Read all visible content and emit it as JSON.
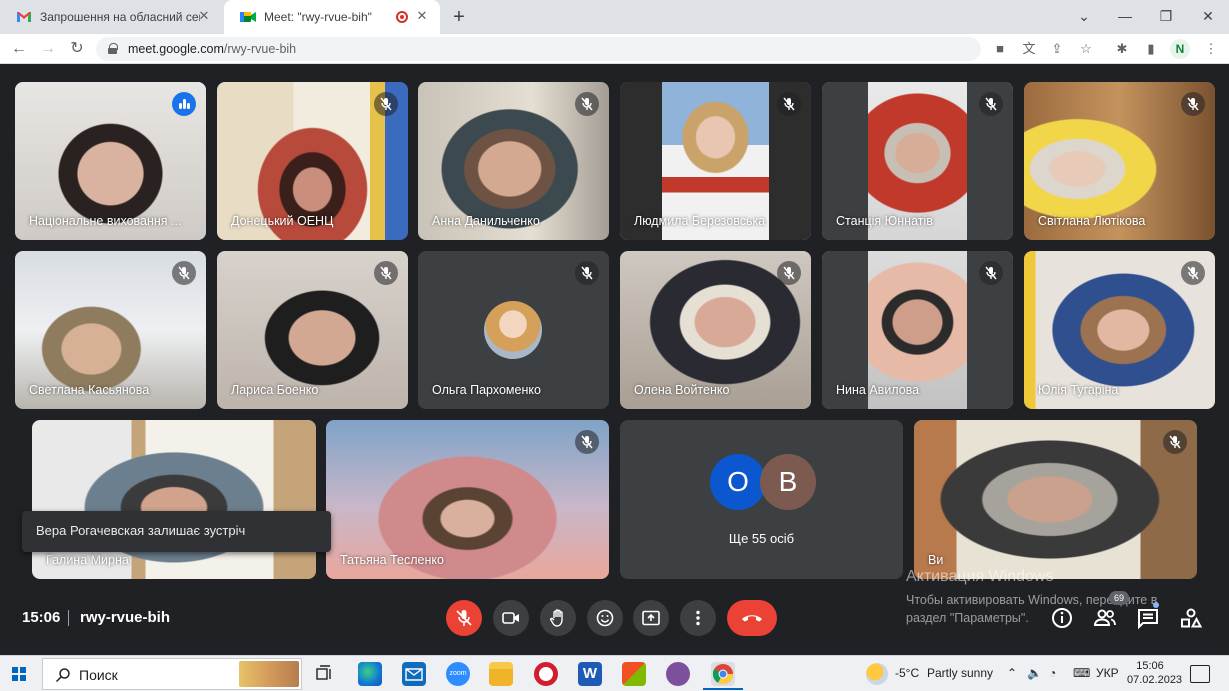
{
  "browser": {
    "tabs": [
      {
        "title": "Запрошення на обласний семі",
        "icon": "gmail-icon"
      },
      {
        "title": "Meet: \"rwy-rvue-bih\"",
        "icon": "meet-icon",
        "active": true
      }
    ],
    "url_host": "meet.google.com",
    "url_path": "/rwy-rvue-bih",
    "profile_initial": "N"
  },
  "meet": {
    "participants": [
      {
        "name": "Національне виховання ...",
        "speaking": true
      },
      {
        "name": "Донецький ОЕНЦ"
      },
      {
        "name": "Анна Данильченко"
      },
      {
        "name": "Людмила Березовська"
      },
      {
        "name": "Станція Юннатів"
      },
      {
        "name": "Світлана Лютікова"
      },
      {
        "name": "Светлана Касьянова"
      },
      {
        "name": "Лариса Боенко"
      },
      {
        "name": "Ольга Пархоменко"
      },
      {
        "name": "Олена Войтенко"
      },
      {
        "name": "Нина Авилова"
      },
      {
        "name": "Юлія Тугаріна"
      },
      {
        "name": "Галина Мирна"
      },
      {
        "name": "Татьяна Тесленко"
      },
      {
        "name": "Ви"
      }
    ],
    "others": {
      "avatars": [
        "О",
        "В"
      ],
      "label": "Ще 55 осіб"
    },
    "toast": "Вера Рогачевская залишає зустріч",
    "time": "15:06",
    "meeting_code": "rwy-rvue-bih",
    "participants_count": "69",
    "colors": {
      "hangup": "#ea4335",
      "speaking": "#1a73e8",
      "avatar_o": "#0b57d0",
      "avatar_b": "#7d5a4f"
    }
  },
  "watermark": {
    "title": "Активация Windows",
    "text": "Чтобы активировать Windows, перейдите в раздел \"Параметры\"."
  },
  "taskbar": {
    "search_label": "Поиск",
    "weather_temp": "-5°C",
    "weather_text": "Partly sunny",
    "lang": "УКР",
    "time": "15:06",
    "date": "07.02.2023"
  }
}
